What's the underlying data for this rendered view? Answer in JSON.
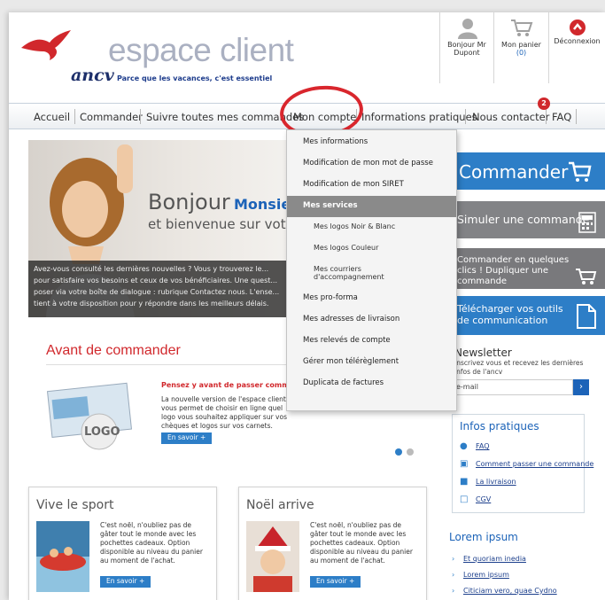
{
  "header": {
    "brand": "ancv",
    "title": "espace client",
    "tagline": "Parce que les vacances, c'est essentiel",
    "user_label": "Bonjour Mr Dupont",
    "cart_label": "Mon panier",
    "cart_count": "(0)",
    "logout_label": "Déconnexion"
  },
  "nav": {
    "items": [
      "Accueil",
      "Commander",
      "Suivre toutes mes commandes",
      "Mon compte",
      "Informations pratiques",
      "Nous contacter",
      "FAQ"
    ],
    "badge": "2"
  },
  "dropdown": {
    "items": [
      "Mes informations",
      "Modification de mon mot de passe",
      "Modification de mon SIRET",
      "Mes services",
      "Mes logos Noir & Blanc",
      "Mes logos Couleur",
      "Mes courriers d'accompagnement",
      "Mes pro-forma",
      "Mes adresses de livraison",
      "Mes relevés de compte",
      "Gérer mon télérèglement",
      "Duplicata de factures"
    ]
  },
  "hero": {
    "hello": "Bonjour",
    "name": "Monsieur",
    "welcome": "et bienvenue sur votre",
    "text": "Avez-vous consulté les dernières nouvelles ? Vous y trouverez le... pour satisfaire vos besoins et ceux de vos bénéficiaires. Une quest... poser via votre boîte de dialogue : rubrique Contactez nous. L'ense... tient à votre disposition pour y répondre dans les meilleurs délais."
  },
  "side": {
    "commander": "Commander",
    "simuler": "Simuler une commande",
    "clics": "Commander en quelques clics ! Dupliquer une commande",
    "dl": "Télécharger vos outils de communication"
  },
  "newsletter": {
    "title": "Newsletter",
    "text": "Inscrivez vous et recevez les dernières infos de l'ancv",
    "placeholder": "e-mail",
    "go": "›"
  },
  "infos": {
    "title": "Infos pratiques",
    "links": [
      "FAQ",
      "Comment passer une commande",
      "La livraison",
      "CGV"
    ]
  },
  "lorem": {
    "title": "Lorem ipsum",
    "links": [
      "Et quoriam inedia",
      "Lorem ipsum",
      "Citiciam vero, quae Cydno"
    ]
  },
  "avant": {
    "title": "Avant de commander",
    "card_logo": "LOGO",
    "heading": "Pensez y avant de passer commande",
    "text": "La nouvelle version de l'espace client, vous permet de choisir en ligne quel logo vous souhaitez appliquer sur vos chèques et logos sur vos carnets.",
    "button": "En savoir +"
  },
  "cards": [
    {
      "title": "Vive le sport",
      "text": "C'est noël, n'oubliez pas de gâter tout le monde avec les pochettes cadeaux. Option disponible au niveau du panier au moment de l'achat.",
      "button": "En savoir +"
    },
    {
      "title": "Noël arrive",
      "text": "C'est noël, n'oubliez pas de gâter tout le monde avec les pochettes cadeaux. Option disponible au niveau du panier au moment de l'achat.",
      "button": "En savoir +"
    }
  ],
  "colors": {
    "accent": "#2d7ec7",
    "brand_red": "#d1282c",
    "navy": "#1d2f6a"
  }
}
